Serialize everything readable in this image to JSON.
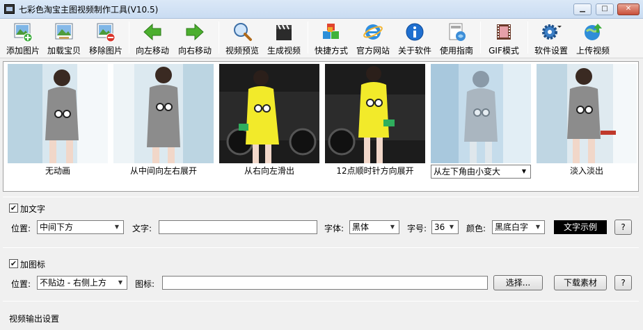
{
  "window": {
    "title": "七彩色淘宝主图视频制作工具(V10.5)",
    "minimize_glyph": "▁",
    "maximize_glyph": "□",
    "close_glyph": "✕"
  },
  "toolbar": {
    "items": [
      {
        "label": "添加图片",
        "icon": "add-image-icon"
      },
      {
        "label": "加载宝贝",
        "icon": "load-product-icon"
      },
      {
        "label": "移除图片",
        "icon": "remove-image-icon"
      },
      {
        "label": "向左移动",
        "icon": "arrow-left-icon"
      },
      {
        "label": "向右移动",
        "icon": "arrow-right-icon"
      },
      {
        "label": "视频预览",
        "icon": "magnifier-icon"
      },
      {
        "label": "生成视频",
        "icon": "clapperboard-icon"
      },
      {
        "label": "快捷方式",
        "icon": "cubes-icon"
      },
      {
        "label": "官方网站",
        "icon": "ie-browser-icon"
      },
      {
        "label": "关于软件",
        "icon": "info-icon"
      },
      {
        "label": "使用指南",
        "icon": "guide-icon"
      },
      {
        "label": "GIF模式",
        "icon": "film-strip-icon"
      },
      {
        "label": "软件设置",
        "icon": "gear-icon"
      },
      {
        "label": "上传视频",
        "icon": "upload-globe-icon"
      }
    ]
  },
  "images": [
    {
      "caption": "无动画",
      "scene": "window"
    },
    {
      "caption": "从中间向左右展开",
      "scene": "window"
    },
    {
      "caption": "从右向左滑出",
      "scene": "car"
    },
    {
      "caption": "12点顺时针方向展开",
      "scene": "car"
    },
    {
      "caption": "从左下角由小变大",
      "scene": "window-faded"
    },
    {
      "caption": "淡入淡出",
      "scene": "window"
    }
  ],
  "text_panel": {
    "checkbox_label": "加文字",
    "checked": true,
    "position_label": "位置:",
    "position_value": "中间下方",
    "text_label": "文字:",
    "text_value": "",
    "font_label": "字体:",
    "font_value": "黑体",
    "size_label": "字号:",
    "size_value": "36",
    "color_label": "颜色:",
    "color_value": "黑底白字",
    "sample_label": "文字示例",
    "help_label": "?"
  },
  "icon_panel": {
    "checkbox_label": "加图标",
    "checked": true,
    "position_label": "位置:",
    "position_value": "不贴边 - 右侧上方",
    "icon_label": "图标:",
    "icon_value": "",
    "choose_label": "选择...",
    "download_label": "下载素材",
    "help_label": "?"
  },
  "output_panel": {
    "heading": "视频输出设置"
  },
  "colors": {
    "dress_gray": "#8c8c8c",
    "dress_yellow": "#f2ea2a",
    "bg_window": "#cfe0ea",
    "bg_car": "#1d1d1d"
  }
}
